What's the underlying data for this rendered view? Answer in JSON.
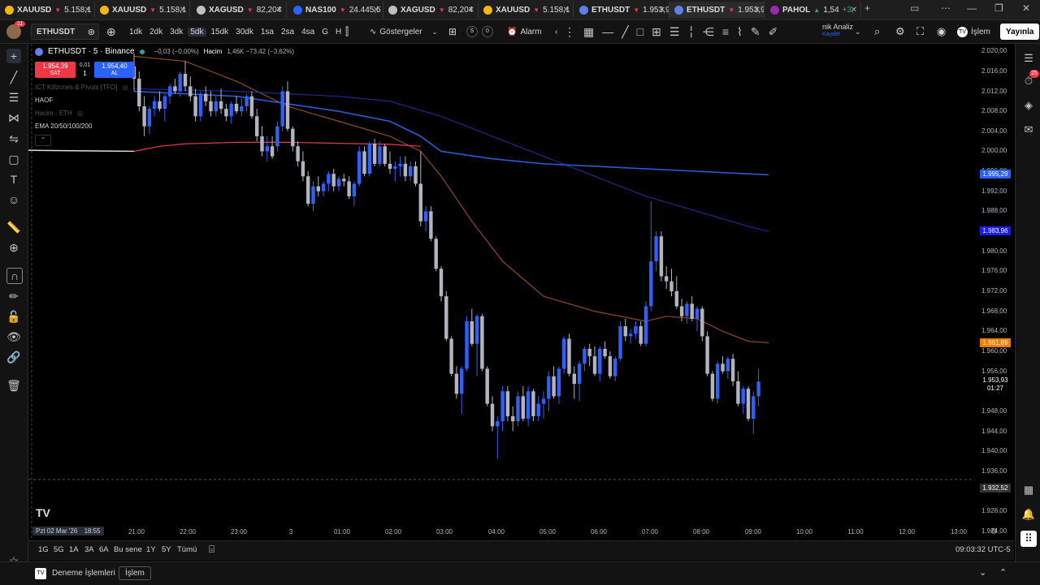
{
  "tabs": [
    {
      "symbol": "XAUUSD",
      "dir": "▼",
      "value": "5.158,1",
      "color": "#f0b90b",
      "active": false
    },
    {
      "symbol": "XAUUSD",
      "dir": "▼",
      "value": "5.158,1",
      "color": "#f0b90b",
      "active": false
    },
    {
      "symbol": "XAGUSD",
      "dir": "▼",
      "value": "82,204",
      "color": "#c0c0c0",
      "active": false
    },
    {
      "symbol": "NAS100",
      "dir": "▼",
      "value": "24.445,5",
      "color": "#2962ff",
      "active": false
    },
    {
      "symbol": "XAGUSD",
      "dir": "▼",
      "value": "82,204",
      "color": "#c0c0c0",
      "active": false
    },
    {
      "symbol": "XAUUSD",
      "dir": "▼",
      "value": "5.158,1",
      "color": "#f0b90b",
      "active": false
    },
    {
      "symbol": "ETHUSDT",
      "dir": "▼",
      "value": "1.953,9",
      "color": "#627eea",
      "active": false
    },
    {
      "symbol": "ETHUSDT",
      "dir": "▼",
      "value": "1.953,9",
      "color": "#627eea",
      "active": true
    },
    {
      "symbol": "PAHOL",
      "dir": "▲",
      "value": "1,54",
      "extra": "+3,",
      "color": "#9c27b0",
      "active": false
    }
  ],
  "header": {
    "avatar_badge": "11",
    "symbol": "ETHUSDT",
    "timeframes": [
      "1dk",
      "2dk",
      "3dk",
      "5dk",
      "15dk",
      "30dk",
      "1sa",
      "2sa",
      "4sa",
      "G",
      "H"
    ],
    "active_timeframe": "5dk",
    "indicators_label": "Göstergeler",
    "alarm_label": "Alarm",
    "pill_s": "S",
    "pill_0": "0",
    "analysis_label": "nik Analiz",
    "save_label": "Kaydet",
    "islem_label": "İşlem",
    "publish_label": "Yayınla"
  },
  "legend": {
    "title": "ETHUSDT · 5 · Binance",
    "change": "−0,03 (−0,00%)",
    "volume_label": "Hacim",
    "volume_values": "1,46K  −73,42 (−3,62%)",
    "sell_price": "1.954,39",
    "sell_label": "SAT",
    "spread": "0,01",
    "qty": "1",
    "buy_price": "1.954,40",
    "buy_label": "AL",
    "indicator_ict": "ICT Killzones & Pivots [TFO]",
    "indicator_haof": "HAOF",
    "indicator_volume": "Hacim - ETH",
    "indicator_ema": "EMA 20/50/100/200"
  },
  "price_axis": {
    "ticks": [
      "2.020,00",
      "2.016,00",
      "2.012,00",
      "2.008,00",
      "2.004,00",
      "2.000,00",
      "1.996,00",
      "1.992,00",
      "1.988,00",
      "1.984,00",
      "1.980,00",
      "1.976,00",
      "1.972,00",
      "1.968,00",
      "1.964,00",
      "1.960,00",
      "1.956,00",
      "1.952,00",
      "1.948,00",
      "1.944,00",
      "1.940,00",
      "1.936,00",
      "1.932,00",
      "1.928,00",
      "1.924,00"
    ],
    "tick_values": [
      2020,
      2016,
      2012,
      2008,
      2004,
      2000,
      1996,
      1992,
      1988,
      1984,
      1980,
      1976,
      1972,
      1968,
      1964,
      1960,
      1956,
      1952,
      1948,
      1944,
      1940,
      1936,
      1932,
      1928,
      1924
    ],
    "tags": [
      {
        "label": "1.995,29",
        "value": 1995.29,
        "color": "#2962ff"
      },
      {
        "label": "1.983,96",
        "value": 1983.96,
        "color": "#1a1aff"
      },
      {
        "label": "1.961,69",
        "value": 1961.69,
        "color": "#f57c00"
      },
      {
        "label": "1.932,52",
        "value": 1932.52,
        "color": "#333333"
      }
    ],
    "last_price": "1.953,93",
    "countdown": "01:27"
  },
  "time_axis": {
    "date_label": "Pzt 02 Mar '26",
    "time_label": "18:55",
    "labels": [
      "21:00",
      "22:00",
      "23:00",
      "3",
      "01:00",
      "02:00",
      "03:00",
      "04:00",
      "05:00",
      "06:00",
      "07:00",
      "08:00",
      "09:00",
      "10:00",
      "11:00",
      "12:00",
      "13:00"
    ]
  },
  "range_bar": {
    "ranges": [
      "1G",
      "5G",
      "1A",
      "3A",
      "6A",
      "Bu sene",
      "1Y",
      "5Y",
      "Tümü"
    ],
    "clock": "09:03:32 UTC-5"
  },
  "bottom_bar": {
    "paper_trading": "Deneme İşlemleri",
    "trade_button": "İşlem"
  },
  "colors": {
    "up": "#2962ff",
    "down": "#b2b5be",
    "ema20": "#8d4a1f",
    "ema50": "#1e2a8c",
    "ema100": "#2a5bd7",
    "ema200_a": "#e0e0e0",
    "ema200_b": "#e53950"
  },
  "chart_data": {
    "type": "candlestick",
    "y_min": 1922.5,
    "y_max": 2021.5,
    "candles": [
      [
        2017,
        2019.5,
        2012,
        2014.5
      ],
      [
        2014.5,
        2016,
        2008,
        2009
      ],
      [
        2009,
        2011,
        2003,
        2005
      ],
      [
        2005,
        2009,
        2003.5,
        2008.5
      ],
      [
        2008.5,
        2011,
        2007,
        2010
      ],
      [
        2010,
        2012,
        2008,
        2008.5
      ],
      [
        2008.5,
        2011.5,
        2006,
        2011
      ],
      [
        2011,
        2013.5,
        2009.5,
        2013
      ],
      [
        2013,
        2014.5,
        2011.5,
        2012
      ],
      [
        2012,
        2016,
        2011,
        2015.5
      ],
      [
        2015.5,
        2018,
        2012,
        2013
      ],
      [
        2013,
        2015,
        2010,
        2011
      ],
      [
        2011,
        2012.5,
        2006,
        2007
      ],
      [
        2007,
        2012,
        2006,
        2011.5
      ],
      [
        2011.5,
        2013,
        2009,
        2010
      ],
      [
        2010,
        2012,
        2007,
        2008
      ],
      [
        2008,
        2011,
        2007,
        2010
      ],
      [
        2010,
        2012.5,
        2007.5,
        2008.5
      ],
      [
        2008.5,
        2009.5,
        2006,
        2007
      ],
      [
        2007,
        2010,
        2005.5,
        2009.5
      ],
      [
        2009.5,
        2011,
        2007.5,
        2008
      ],
      [
        2008,
        2010.5,
        2007,
        2009
      ],
      [
        2009,
        2011.5,
        2008,
        2011
      ],
      [
        2011,
        2012,
        2006.5,
        2007
      ],
      [
        2007,
        2008.5,
        2002,
        2003
      ],
      [
        2003,
        2005,
        1999,
        2000
      ],
      [
        2000,
        2003,
        1998,
        2001
      ],
      [
        2001,
        2003,
        1998.5,
        1999
      ],
      [
        2001,
        2006,
        2000,
        2005
      ],
      [
        2005,
        2013,
        2004,
        2012
      ],
      [
        2012,
        2014,
        2004,
        2004.5
      ],
      [
        2004.5,
        2005,
        2000,
        2001
      ],
      [
        2001,
        2002,
        1997,
        1998
      ],
      [
        1998,
        2000,
        1994,
        1995
      ],
      [
        1995,
        1996,
        1989,
        1989.5
      ],
      [
        1989.5,
        1994,
        1988,
        1993
      ],
      [
        1993,
        1995,
        1991,
        1992
      ],
      [
        1992,
        1994,
        1991,
        1993.5
      ],
      [
        1993.5,
        1996,
        1992,
        1995.5
      ],
      [
        1995.5,
        1996.5,
        1992,
        1993
      ],
      [
        1993,
        1995,
        1992,
        1994.5
      ],
      [
        1994.5,
        1995.5,
        1993,
        1994
      ],
      [
        1994,
        1995,
        1990.5,
        1991
      ],
      [
        1991,
        1994,
        1989,
        1993.5
      ],
      [
        1993.5,
        2001,
        1993,
        2000
      ],
      [
        2000,
        2001,
        1995,
        1995.5
      ],
      [
        1995.5,
        2002,
        1995,
        2001.5
      ],
      [
        2001.5,
        2002.5,
        1997,
        1997.5
      ],
      [
        1997.5,
        2002,
        1997,
        2001
      ],
      [
        2001,
        2001.5,
        1997,
        1997.5
      ],
      [
        1997.5,
        2000,
        1995.5,
        1996.5
      ],
      [
        1996.5,
        1998,
        1994,
        1997
      ],
      [
        1997,
        1999,
        1995,
        1997.5
      ],
      [
        1997.5,
        1999,
        1994,
        1995
      ],
      [
        1995,
        1998,
        1994,
        1997
      ],
      [
        1997,
        1998,
        1993,
        1993.5
      ],
      [
        1993.5,
        2000,
        1985,
        1986
      ],
      [
        1986,
        1989,
        1984,
        1988
      ],
      [
        1988,
        1989,
        1982,
        1982.5
      ],
      [
        1982.5,
        1983,
        1976,
        1976.5
      ],
      [
        1976.5,
        1977,
        1970,
        1971
      ],
      [
        1971,
        1972,
        1962,
        1962.5
      ],
      [
        1962.5,
        1963,
        1955,
        1955.5
      ],
      [
        1955.5,
        1957,
        1950.5,
        1951.5
      ],
      [
        1951.5,
        1957,
        1947.5,
        1956.5
      ],
      [
        1956.5,
        1967,
        1956,
        1966
      ],
      [
        1966,
        1968.5,
        1961,
        1961.5
      ],
      [
        1961.5,
        1967.5,
        1955,
        1967
      ],
      [
        1967,
        1967.5,
        1956,
        1956.5
      ],
      [
        1956.5,
        1957,
        1949,
        1949.5
      ],
      [
        1949.5,
        1951,
        1944,
        1945
      ],
      [
        1945,
        1947,
        1938.5,
        1946
      ],
      [
        1946,
        1953,
        1944,
        1952
      ],
      [
        1952,
        1953,
        1946,
        1947
      ],
      [
        1947,
        1949,
        1944,
        1946
      ],
      [
        1946,
        1952,
        1945,
        1951
      ],
      [
        1951,
        1953,
        1946,
        1946.5
      ],
      [
        1946.5,
        1953,
        1945,
        1952
      ],
      [
        1952,
        1952.5,
        1946,
        1947
      ],
      [
        1947,
        1951,
        1946,
        1949.5
      ],
      [
        1949.5,
        1952,
        1946.5,
        1950.5
      ],
      [
        1950.5,
        1956,
        1948,
        1955
      ],
      [
        1955,
        1957,
        1950.5,
        1951
      ],
      [
        1951,
        1957,
        1949.5,
        1956.5
      ],
      [
        1956.5,
        1963,
        1955.5,
        1962.5
      ],
      [
        1962.5,
        1963.5,
        1955,
        1955.5
      ],
      [
        1955.5,
        1957,
        1950.5,
        1953.5
      ],
      [
        1953.5,
        1958,
        1950,
        1957.5
      ],
      [
        1957.5,
        1961,
        1956,
        1960.5
      ],
      [
        1960.5,
        1961.5,
        1957,
        1959
      ],
      [
        1959,
        1961,
        1955,
        1955.5
      ],
      [
        1955.5,
        1961,
        1954,
        1960.5
      ],
      [
        1960.5,
        1962,
        1958.5,
        1959
      ],
      [
        1959,
        1960,
        1954.5,
        1955
      ],
      [
        1955,
        1959,
        1954,
        1958.5
      ],
      [
        1958.5,
        1966,
        1958,
        1965
      ],
      [
        1965,
        1966.5,
        1962,
        1963
      ],
      [
        1963,
        1964.5,
        1961.5,
        1963.5
      ],
      [
        1963.5,
        1966,
        1962.5,
        1965
      ],
      [
        1965,
        1966,
        1961,
        1961.5
      ],
      [
        1961.5,
        1970,
        1961,
        1969
      ],
      [
        1969,
        1990,
        1968,
        1978
      ],
      [
        1978,
        1984,
        1976,
        1983
      ],
      [
        1983,
        1984,
        1974,
        1975
      ],
      [
        1975,
        1977,
        1972.5,
        1974
      ],
      [
        1974,
        1976.5,
        1971,
        1972
      ],
      [
        1972,
        1975,
        1968.5,
        1969
      ],
      [
        1969,
        1970.5,
        1966,
        1967
      ],
      [
        1967,
        1970,
        1965.5,
        1969.5
      ],
      [
        1969.5,
        1971,
        1966,
        1966.5
      ],
      [
        1966.5,
        1969,
        1964,
        1968.5
      ],
      [
        1968.5,
        1969,
        1962,
        1963
      ],
      [
        1963,
        1964,
        1955,
        1955.5
      ],
      [
        1955.5,
        1956,
        1950,
        1950.5
      ],
      [
        1950.5,
        1958,
        1949.5,
        1957.5
      ],
      [
        1957.5,
        1959,
        1955.5,
        1956
      ],
      [
        1956,
        1959,
        1954.5,
        1958.5
      ],
      [
        1958.5,
        1959.5,
        1953,
        1954
      ],
      [
        1954,
        1956,
        1949,
        1949.5
      ],
      [
        1949.5,
        1953,
        1947.5,
        1952.5
      ],
      [
        1952.5,
        1953,
        1946,
        1946.5
      ],
      [
        1946.5,
        1952,
        1943.5,
        1951
      ],
      [
        1951,
        1956.5,
        1949,
        1953.93
      ]
    ],
    "ema": [
      {
        "name": "EMA 20",
        "points": [
          [
            0,
            2019
          ],
          [
            10,
            2018
          ],
          [
            20,
            2014
          ],
          [
            30,
            2009
          ],
          [
            40,
            2006
          ],
          [
            50,
            2003
          ],
          [
            56,
            2000
          ],
          [
            60,
            1995
          ],
          [
            66,
            1986
          ],
          [
            72,
            1978
          ],
          [
            80,
            1971
          ],
          [
            90,
            1968
          ],
          [
            100,
            1966
          ],
          [
            104,
            1967
          ],
          [
            110,
            1966.5
          ],
          [
            115,
            1964
          ],
          [
            120,
            1962
          ],
          [
            124,
            1961.69
          ]
        ]
      },
      {
        "name": "EMA 50",
        "points": [
          [
            0,
            2012.5
          ],
          [
            20,
            2012
          ],
          [
            40,
            2011
          ],
          [
            50,
            2010
          ],
          [
            60,
            2007
          ],
          [
            70,
            2003
          ],
          [
            80,
            1999
          ],
          [
            90,
            1995
          ],
          [
            100,
            1991
          ],
          [
            110,
            1988
          ],
          [
            120,
            1985
          ],
          [
            124,
            1983.96
          ]
        ]
      },
      {
        "name": "EMA 100",
        "points": [
          [
            0,
            2012
          ],
          [
            20,
            2011
          ],
          [
            40,
            2008
          ],
          [
            50,
            2006
          ],
          [
            56,
            2003
          ],
          [
            60,
            2000
          ],
          [
            70,
            1998.5
          ],
          [
            80,
            1997.5
          ],
          [
            90,
            1997
          ],
          [
            100,
            1996.5
          ],
          [
            110,
            1996
          ],
          [
            124,
            1995.29
          ]
        ]
      },
      {
        "name": "EMA 200",
        "points": [
          [
            0,
            2000
          ],
          [
            5,
            2001
          ],
          [
            10,
            2001.5
          ],
          [
            20,
            2001.8
          ],
          [
            30,
            2001.8
          ],
          [
            40,
            2001.6
          ],
          [
            50,
            2001.4
          ],
          [
            56,
            2001
          ]
        ]
      }
    ]
  }
}
